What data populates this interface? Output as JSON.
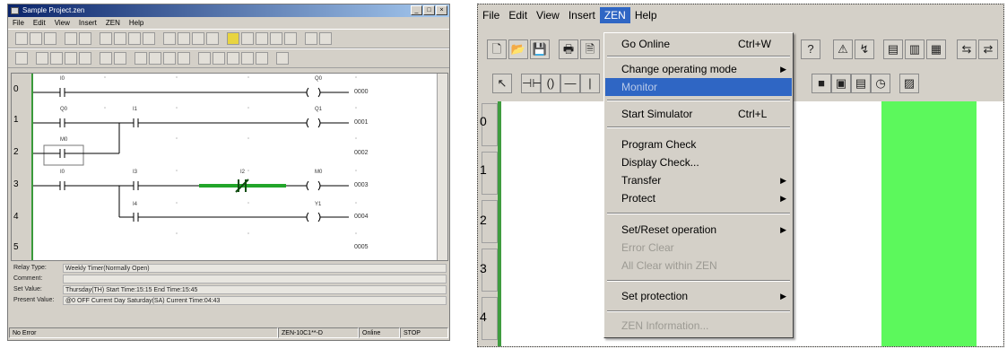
{
  "left_window": {
    "title": "Sample Project.zen",
    "menu": [
      "File",
      "Edit",
      "View",
      "Insert",
      "ZEN",
      "Help"
    ],
    "rows": [
      "0",
      "1",
      "2",
      "3",
      "4",
      "5"
    ],
    "contacts": [
      "I0",
      "Q0",
      "I1",
      "M0",
      "I0",
      "I3",
      "I2",
      "I4"
    ],
    "coils": [
      "Q0",
      "Q1",
      "M0",
      "Y1"
    ],
    "addresses": [
      "0000",
      "0001",
      "0002",
      "0003",
      "0004",
      "0005"
    ],
    "info": {
      "relay_type_label": "Relay Type:",
      "relay_type_value": "Weekly Timer(Normally Open)",
      "comment_label": "Comment:",
      "comment_value": "",
      "set_value_label": "Set Value:",
      "set_value_value": "Thursday(TH)  Start Time:15:15 End Time:15:45",
      "present_label": "Present Value:",
      "present_value": "@0 OFF Current Day Saturday(SA) Current Time:04:43"
    },
    "status": {
      "error": "No Error",
      "model": "ZEN-10C1**-D",
      "mode": "Online",
      "state": "STOP"
    }
  },
  "right_window": {
    "menu": [
      "File",
      "Edit",
      "View",
      "Insert",
      "ZEN",
      "Help"
    ],
    "active_menu": "ZEN",
    "rows": [
      "0",
      "1",
      "2",
      "3",
      "4"
    ],
    "dropdown": [
      {
        "label": "Go Online",
        "shortcut": "Ctrl+W"
      },
      {
        "label": "Change operating mode"
      },
      {
        "label": "Monitor"
      },
      {
        "label": "Start Simulator",
        "shortcut": "Ctrl+L"
      },
      {
        "label": "Program Check"
      },
      {
        "label": "Display Check..."
      },
      {
        "label": "Transfer"
      },
      {
        "label": "Protect"
      },
      {
        "label": "Set/Reset operation"
      },
      {
        "label": "Error Clear"
      },
      {
        "label": "All Clear within ZEN"
      },
      {
        "label": "Set protection"
      },
      {
        "label": "ZEN Information..."
      }
    ]
  },
  "colors": {
    "highlight": "#2f66c4",
    "monitor_green": "#5cf85c",
    "rail_green": "#3f9c3f"
  }
}
